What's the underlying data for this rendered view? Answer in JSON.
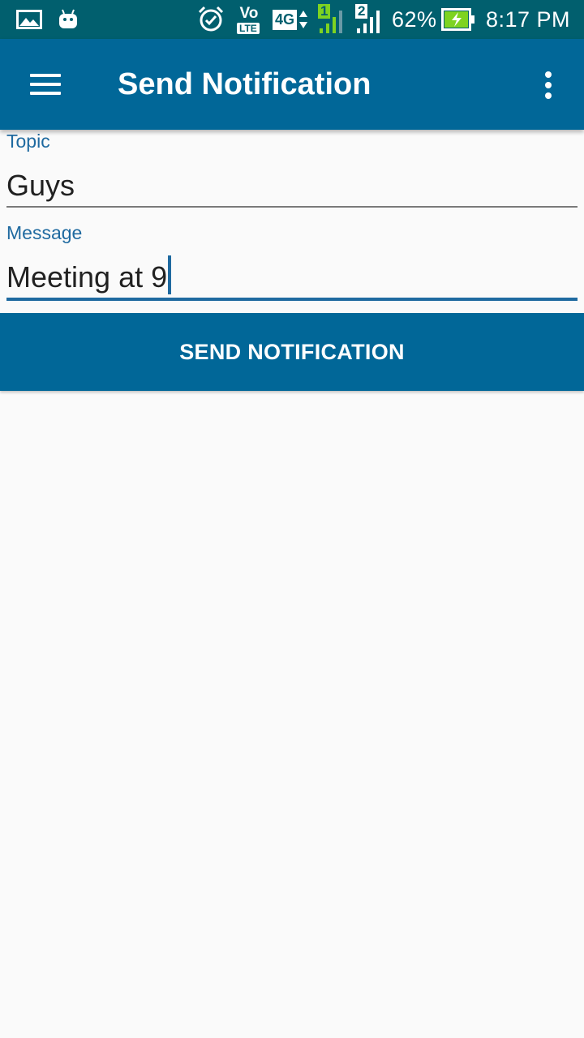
{
  "status_bar": {
    "battery_percent": "62%",
    "time": "8:17 PM",
    "network_type": "4G",
    "volte_top": "Vo",
    "volte_bottom": "LTE",
    "sim1_label": "1",
    "sim2_label": "2",
    "icons": [
      "gallery-icon",
      "android-icon",
      "alarm-icon",
      "volte-icon",
      "4g-icon",
      "signal-sim1-icon",
      "signal-sim2-icon",
      "battery-charging-icon"
    ],
    "colors": {
      "background": "#015f6e",
      "sim1_signal": "#7ed321",
      "battery_fill": "#7ed321"
    }
  },
  "app_bar": {
    "title": "Send Notification",
    "menu_icon": "hamburger-menu-icon",
    "overflow_icon": "more-vert-icon",
    "color": "#016798"
  },
  "form": {
    "topic": {
      "label": "Topic",
      "value": "Guys"
    },
    "message": {
      "label": "Message",
      "value": "Meeting at 9",
      "focused": true
    }
  },
  "send_button": {
    "label": "SEND NOTIFICATION",
    "color": "#016798"
  },
  "accent_color": "#1f6aa0"
}
